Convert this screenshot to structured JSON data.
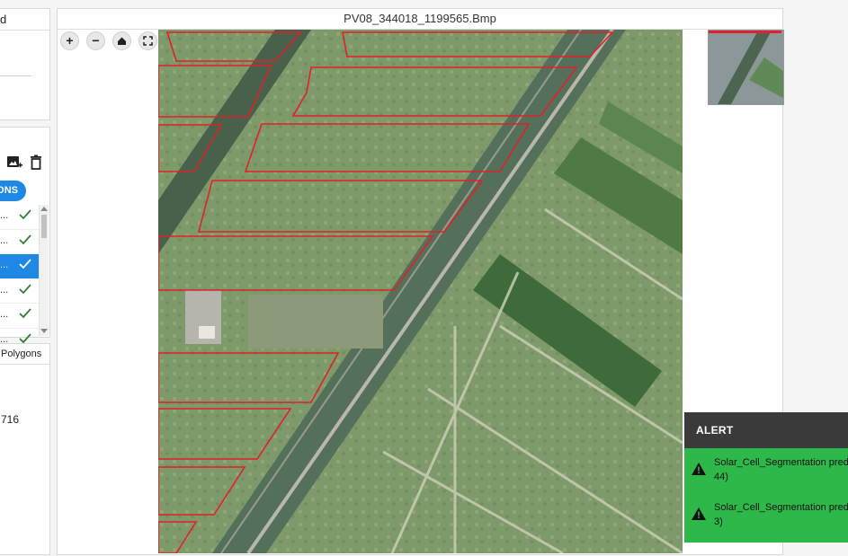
{
  "left_top": {
    "header": "d"
  },
  "left_mid": {
    "pill_label": "ONS",
    "rows": [
      {
        "text": "...",
        "selected": false
      },
      {
        "text": "...",
        "selected": false
      },
      {
        "text": "...",
        "selected": true
      },
      {
        "text": "...",
        "selected": false
      },
      {
        "text": "...",
        "selected": false
      },
      {
        "text": "...",
        "selected": false
      }
    ]
  },
  "left_bottom": {
    "header": "Polygons",
    "value": "716"
  },
  "viewer": {
    "title": "PV08_344018_1199565.Bmp",
    "toolbar": {
      "zoom_in": "+",
      "zoom_out": "−"
    }
  },
  "alert": {
    "title": "ALERT",
    "messages": [
      {
        "line1": "Solar_Cell_Segmentation pred",
        "line2": "44)"
      },
      {
        "line1": "Solar_Cell_Segmentation pred",
        "line2": "3)"
      }
    ]
  },
  "colors": {
    "accent": "#1e88e5",
    "alert_success": "#2eb84a",
    "alert_header": "#3a3a3a",
    "polygon_outline": "#e0202a"
  }
}
